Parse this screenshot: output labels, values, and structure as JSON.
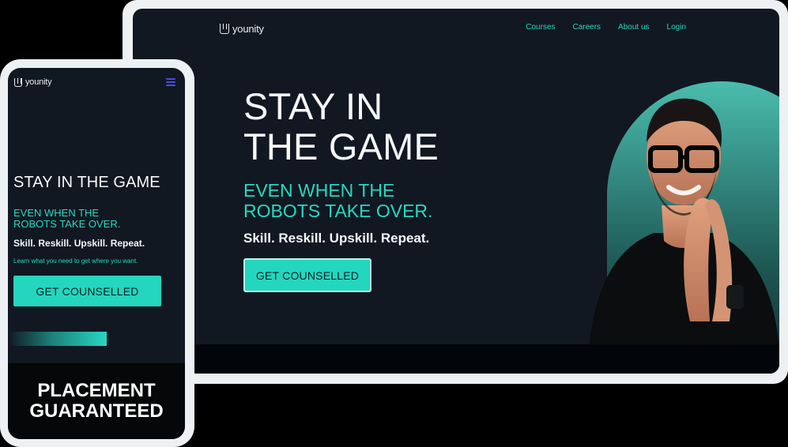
{
  "desktop": {
    "brand_name": "younity",
    "nav": {
      "courses": "Courses",
      "careers": "Careers",
      "about": "About us",
      "login": "Login"
    },
    "hero": {
      "title_line1": "STAY IN",
      "title_line2": "THE GAME",
      "subtitle_line1": "EVEN WHEN THE",
      "subtitle_line2": "ROBOTS TAKE OVER.",
      "tagline": "Skill. Reskill. Upskill. Repeat.",
      "cta_label": "GET COUNSELLED"
    }
  },
  "mobile": {
    "brand_name": "younity",
    "menu_icon": "hamburger-icon",
    "hero": {
      "title": "STAY IN THE GAME",
      "subtitle_line1": "EVEN WHEN THE",
      "subtitle_line2": "ROBOTS TAKE OVER.",
      "tagline": "Skill. Reskill. Upskill. Repeat.",
      "small_text": "Learn what you need to get where you want.",
      "cta_label": "GET COUNSELLED"
    },
    "banner": {
      "line1": "PLACEMENT",
      "line2": "GUARANTEED"
    }
  },
  "colors": {
    "background": "#000000",
    "device_frame": "#eef1f4",
    "screen": "#111822",
    "accent": "#27d8c2",
    "text": "#f5f7f8"
  }
}
